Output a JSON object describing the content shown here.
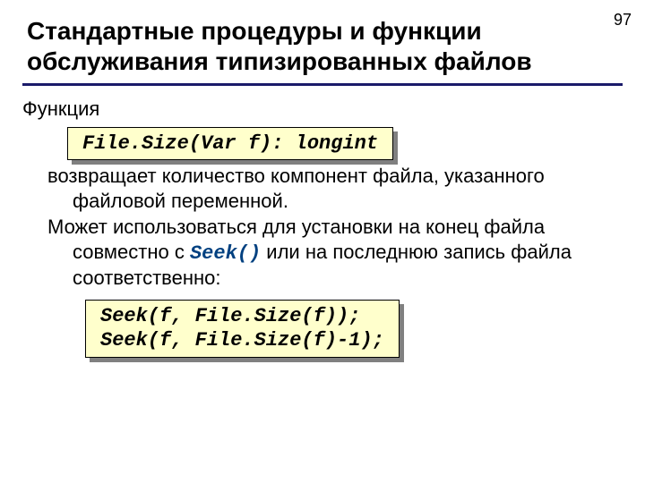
{
  "page_number": "97",
  "title_line1": "Стандартные процедуры и функции",
  "title_line2": "обслуживания типизированных файлов",
  "intro": "Функция",
  "code1": "File.Size(Var f): longint",
  "desc_l1": "возвращает количество компонент файла, указанного файловой переменной.",
  "desc_l2a": "Может использоваться для установки на конец файла совместно с ",
  "seek_inline": "Seek()",
  "desc_l2b": " или на последнюю запись файла соответственно:",
  "code2_l1": "Seek(f, File.Size(f));",
  "code2_l2": "Seek(f, File.Size(f)-1);"
}
